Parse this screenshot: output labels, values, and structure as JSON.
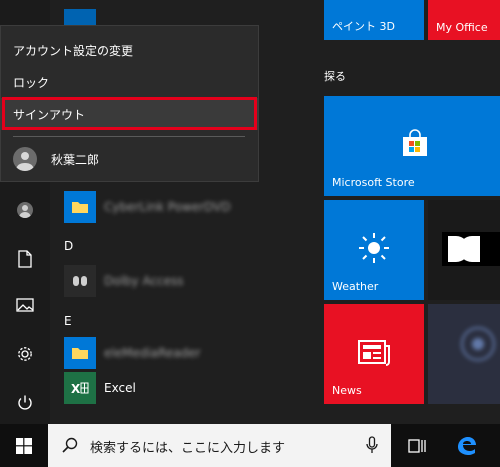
{
  "flyout": {
    "change_account_settings": "アカウント設定の変更",
    "lock": "ロック",
    "sign_out": "サインアウト",
    "user_name": "秋葉二郎"
  },
  "app_list": {
    "blurred_app_1": "CyberLink PowerDVD",
    "letter_d": "D",
    "blurred_app_2": "Dolby Access",
    "letter_e": "E",
    "blurred_app_3": "eleMediaReader",
    "excel": "Excel"
  },
  "tiles": {
    "paint3d": "ペイント 3D",
    "my_office": "My Office",
    "group_title": "探る",
    "store": "Microsoft Store",
    "weather": "Weather",
    "news": "News"
  },
  "taskbar": {
    "search_placeholder": "検索するには、ここに入力します"
  },
  "colors": {
    "accent_blue": "#0078d7",
    "office_red": "#e81123",
    "news_red": "#e81123",
    "highlight_red": "#e4001b"
  }
}
